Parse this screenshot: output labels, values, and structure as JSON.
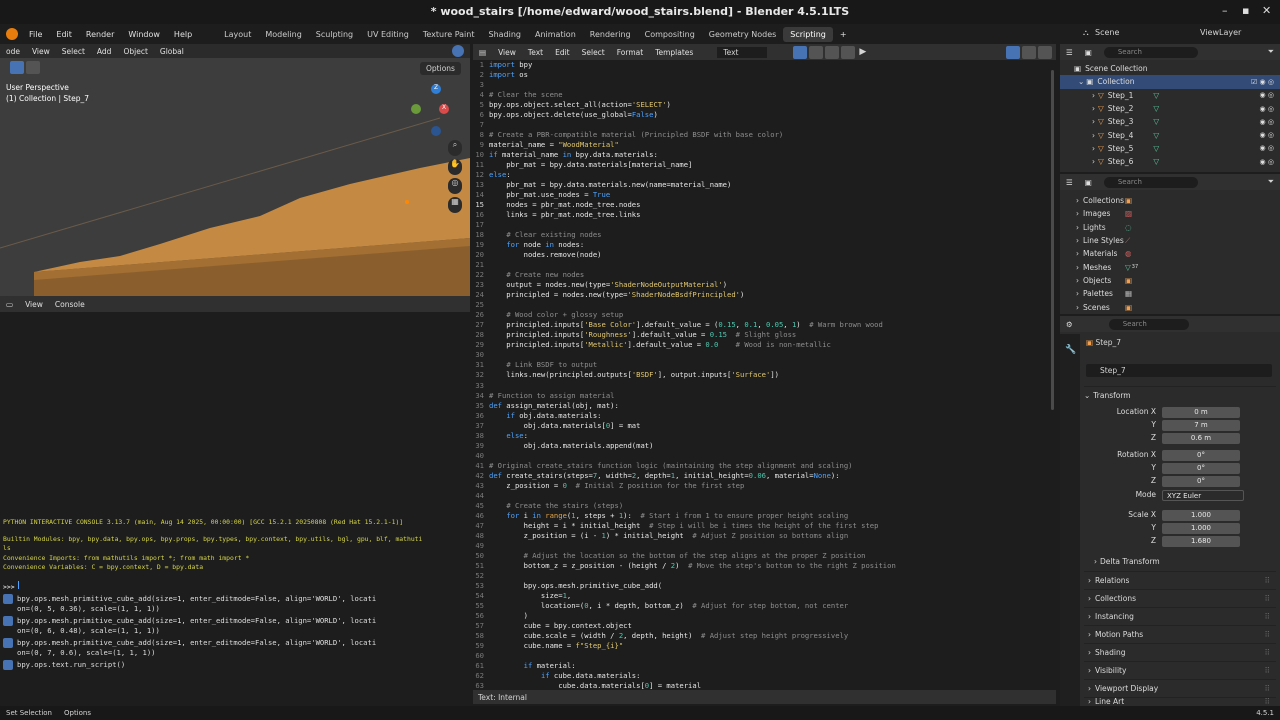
{
  "title": "* wood_stairs [/home/edward/wood_stairs.blend] - Blender 4.5.1LTS",
  "window_controls": [
    "–",
    "▪",
    "✕"
  ],
  "menu": [
    "File",
    "Edit",
    "Render",
    "Window",
    "Help"
  ],
  "workspaces": [
    "Layout",
    "Modeling",
    "Sculpting",
    "UV Editing",
    "Texture Paint",
    "Shading",
    "Animation",
    "Rendering",
    "Compositing",
    "Geometry Nodes",
    "Scripting"
  ],
  "active_workspace": "Scripting",
  "scene": {
    "label": "Scene",
    "viewlayer": "ViewLayer"
  },
  "viewport": {
    "menu": [
      "ode",
      "View",
      "Select",
      "Add",
      "Object"
    ],
    "orientation": "Global",
    "options": "Options",
    "overlay_line1": "User Perspective",
    "overlay_line2": "(1) Collection | Step_7",
    "gizmo": {
      "z": "Z",
      "y": "Y",
      "x": "X"
    }
  },
  "console": {
    "menu": [
      "View",
      "Console"
    ],
    "banner": "PYTHON INTERACTIVE CONSOLE 3.13.7 (main, Aug 14 2025, 00:00:00) [GCC 15.2.1 20250808 (Red Hat 15.2.1-1)]",
    "builtin": [
      "Builtin Modules:      bpy, bpy.data, bpy.ops, bpy.props, bpy.types, bpy.context, bpy.utils, bgl, gpu, blf, mathuti",
      "ls"
    ],
    "conv_imports": "Convenience Imports:   from mathutils import *; from math import *",
    "conv_vars": "Convenience Variables: C = bpy.context, D = bpy.data",
    "prompt": ">>> ",
    "info": [
      [
        "bpy.ops.mesh.primitive_cube_add(size=1, enter_editmode=False, align='WORLD', locati",
        "on=(0, 5, 0.36), scale=(1, 1, 1))"
      ],
      [
        "bpy.ops.mesh.primitive_cube_add(size=1, enter_editmode=False, align='WORLD', locati",
        "on=(0, 6, 0.48), scale=(1, 1, 1))"
      ],
      [
        "bpy.ops.mesh.primitive_cube_add(size=1, enter_editmode=False, align='WORLD', locati",
        "on=(0, 7, 0.6), scale=(1, 1, 1))"
      ],
      [
        "bpy.ops.text.run_script()"
      ]
    ]
  },
  "editor": {
    "menu": [
      "View",
      "Text",
      "Edit",
      "Select",
      "Format",
      "Templates"
    ],
    "text_name": "Text",
    "footer": "Text: Internal",
    "current_line": 15,
    "lines": [
      "import bpy",
      "import os",
      "",
      "# Clear the scene",
      "bpy.ops.object.select_all(action='SELECT')",
      "bpy.ops.object.delete(use_global=False)",
      "",
      "# Create a PBR-compatible material (Principled BSDF with base color)",
      "material_name = \"WoodMaterial\"",
      "if material_name in bpy.data.materials:",
      "    pbr_mat = bpy.data.materials[material_name]",
      "else:",
      "    pbr_mat = bpy.data.materials.new(name=material_name)",
      "    pbr_mat.use_nodes = True",
      "    nodes = pbr_mat.node_tree.nodes",
      "    links = pbr_mat.node_tree.links",
      "",
      "    # Clear existing nodes",
      "    for node in nodes:",
      "        nodes.remove(node)",
      "",
      "    # Create new nodes",
      "    output = nodes.new(type='ShaderNodeOutputMaterial')",
      "    principled = nodes.new(type='ShaderNodeBsdfPrincipled')",
      "",
      "    # Wood color + glossy setup",
      "    principled.inputs['Base Color'].default_value = (0.15, 0.1, 0.05, 1)  # Warm brown wood",
      "    principled.inputs['Roughness'].default_value = 0.15  # Slight gloss",
      "    principled.inputs['Metallic'].default_value = 0.0    # Wood is non-metallic",
      "",
      "    # Link BSDF to output",
      "    links.new(principled.outputs['BSDF'], output.inputs['Surface'])",
      "",
      "# Function to assign material",
      "def assign_material(obj, mat):",
      "    if obj.data.materials:",
      "        obj.data.materials[0] = mat",
      "    else:",
      "        obj.data.materials.append(mat)",
      "",
      "# Original create_stairs function logic (maintaining the step alignment and scaling)",
      "def create_stairs(steps=7, width=2, depth=1, initial_height=0.06, material=None):",
      "    z_position = 0  # Initial Z position for the first step",
      "",
      "    # Create the stairs (steps)",
      "    for i in range(1, steps + 1):  # Start i from 1 to ensure proper height scaling",
      "        height = i * initial_height  # Step i will be i times the height of the first step",
      "        z_position = (i - 1) * initial_height  # Adjust Z position so bottoms align",
      "",
      "        # Adjust the location so the bottom of the step aligns at the proper Z position",
      "        bottom_z = z_position - (height / 2)  # Move the step's bottom to the right Z position",
      "",
      "        bpy.ops.mesh.primitive_cube_add(",
      "            size=1,",
      "            location=(0, i * depth, bottom_z)  # Adjust for step bottom, not center",
      "        )",
      "        cube = bpy.context.object",
      "        cube.scale = (width / 2, depth, height)  # Adjust step height progressively",
      "        cube.name = f\"Step_{i}\"",
      "",
      "        if material:",
      "            if cube.data.materials:",
      "                cube.data.materials[0] = material"
    ]
  },
  "outliner": {
    "search_placeholder": "Search",
    "scene_collection": "Scene Collection",
    "collection": "Collection",
    "items": [
      "Step_1",
      "Step_2",
      "Step_3",
      "Step_4",
      "Step_5",
      "Step_6"
    ]
  },
  "datablocks": {
    "search_placeholder": "Search",
    "items": [
      "Collections",
      "Images",
      "Lights",
      "Line Styles",
      "Materials",
      "Meshes",
      "Objects",
      "Palettes",
      "Scenes"
    ],
    "meshes_count": "37"
  },
  "properties": {
    "search_placeholder": "Search",
    "object_name": "Step_7",
    "object_field": "Step_7",
    "transform_label": "Transform",
    "location": {
      "label": "Location X",
      "x": "0 m",
      "y": "7 m",
      "z": "0.6 m"
    },
    "rotation": {
      "label": "Rotation X",
      "x": "0°",
      "y": "0°",
      "z": "0°"
    },
    "mode": {
      "label": "Mode",
      "value": "XYZ Euler"
    },
    "scale": {
      "label": "Scale X",
      "x": "1.000",
      "y": "1.000",
      "z": "1.680"
    },
    "axis_y": "Y",
    "axis_z": "Z",
    "delta": "Delta Transform",
    "sections": [
      "Relations",
      "Collections",
      "Instancing",
      "Motion Paths",
      "Shading",
      "Visibility",
      "Viewport Display"
    ],
    "cut_section": "Line Art"
  },
  "status": {
    "left": "Set Selection",
    "options": "Options",
    "version": "4.5.1"
  }
}
